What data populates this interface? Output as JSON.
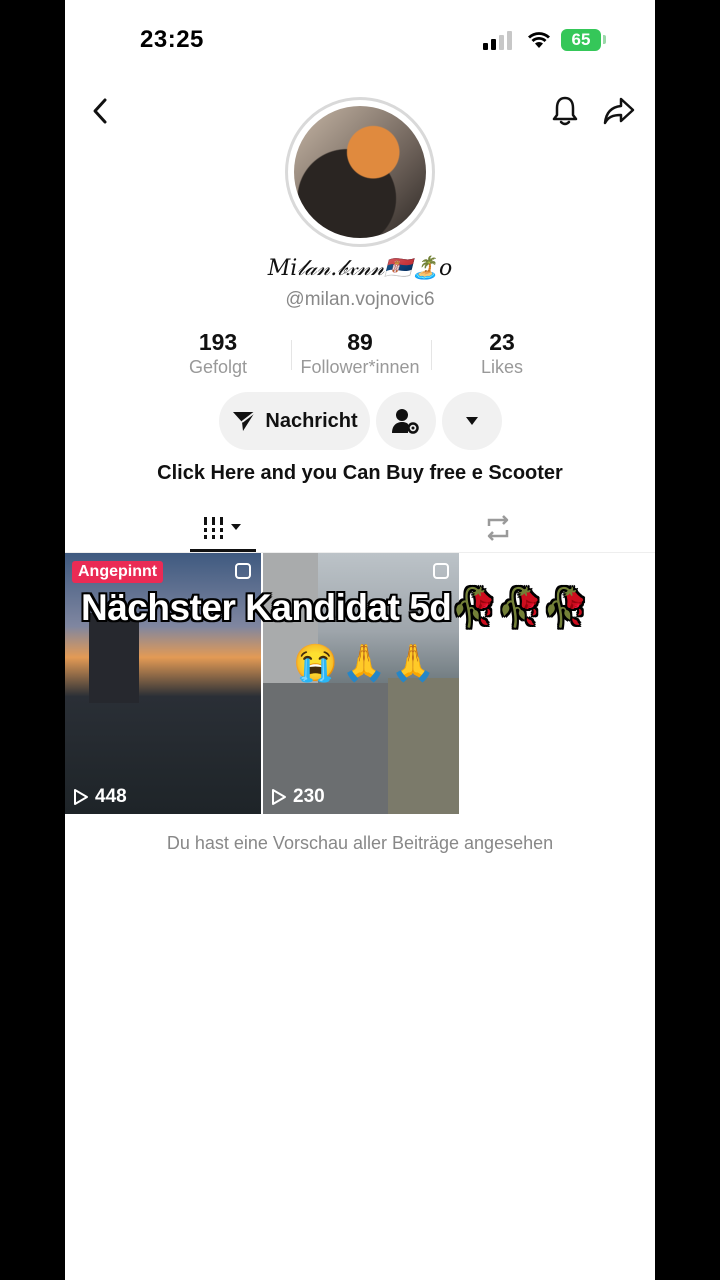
{
  "status_bar": {
    "time": "23:25",
    "battery": "65"
  },
  "profile": {
    "display_name": "𝑀𝑖𝓁𝒶𝓃.𝒷𝓍𝓃𝓃🇷🇸🏝️o",
    "handle": "@milan.vojnovic6",
    "stats": [
      {
        "value": "193",
        "label": "Gefolgt"
      },
      {
        "value": "89",
        "label": "Follower*innen"
      },
      {
        "value": "23",
        "label": "Likes"
      }
    ],
    "message_button": "Nachricht",
    "bio": "Click Here and you Can Buy free e Scooter"
  },
  "videos": [
    {
      "badge": "Angepinnt",
      "views": "448"
    },
    {
      "views": "230"
    }
  ],
  "overlay": {
    "caption": "Nächster Kandidat 5d🥀🥀🥀",
    "emoji_line": "😭🙏🙏"
  },
  "footer_note": "Du hast eine Vorschau aller Beiträge angesehen",
  "icons": {
    "back": "chevron-left-icon",
    "bell": "bell-icon",
    "share": "share-arrow-icon",
    "add_friend": "person-settings-icon",
    "more": "triangle-down-icon",
    "grid_tab": "grid-filter-icon",
    "repost_tab": "repost-icon"
  },
  "colors": {
    "pinned_badge": "#ea2b55",
    "battery": "#35c759"
  }
}
